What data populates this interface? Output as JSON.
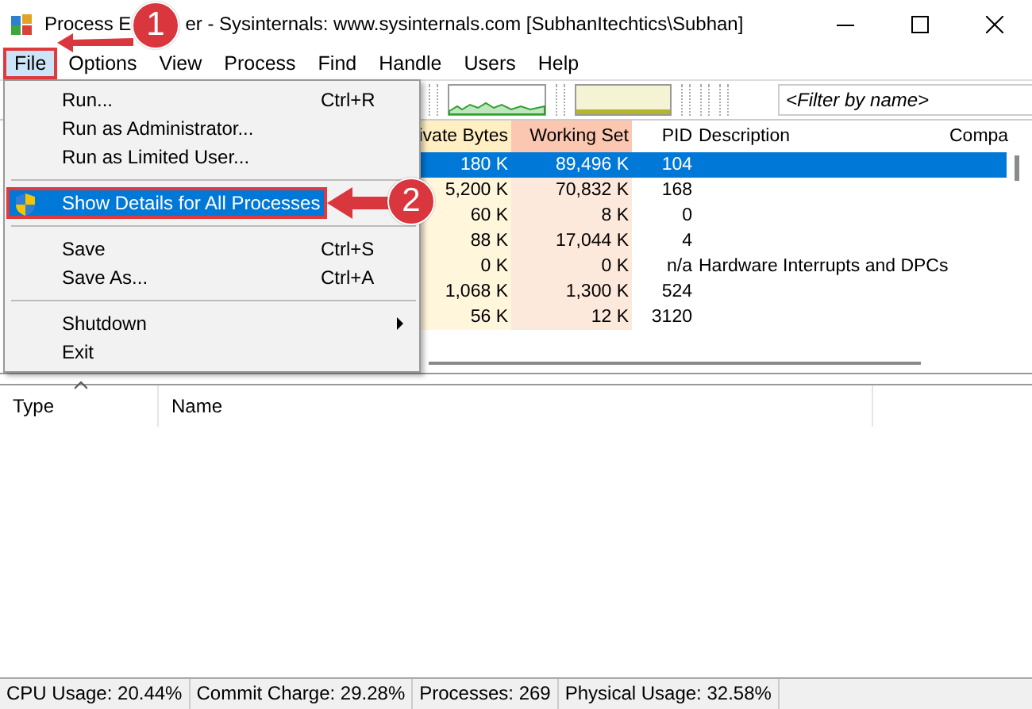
{
  "window": {
    "title_parts": [
      "Process E",
      "er - Sysinternals: www.sysinternals.com [SubhanItechtics\\Subhan]"
    ]
  },
  "menu_bar": [
    {
      "label": "File",
      "selected": true
    },
    {
      "label": "Options",
      "selected": false
    },
    {
      "label": "View",
      "selected": false
    },
    {
      "label": "Process",
      "selected": false
    },
    {
      "label": "Find",
      "selected": false
    },
    {
      "label": "Handle",
      "selected": false
    },
    {
      "label": "Users",
      "selected": false
    },
    {
      "label": "Help",
      "selected": false
    }
  ],
  "file_menu": [
    {
      "kind": "item",
      "label": "Run...",
      "shortcut": "Ctrl+R",
      "selected": false
    },
    {
      "kind": "item",
      "label": "Run as Administrator...",
      "selected": false
    },
    {
      "kind": "item",
      "label": "Run as Limited User...",
      "selected": false
    },
    {
      "kind": "separator"
    },
    {
      "kind": "admin-item",
      "label": "Show Details for All Processes",
      "selected": true
    },
    {
      "kind": "separator"
    },
    {
      "kind": "item",
      "label": "Save",
      "shortcut": "Ctrl+S",
      "selected": false
    },
    {
      "kind": "item",
      "label": "Save As...",
      "shortcut": "Ctrl+A",
      "selected": false
    },
    {
      "kind": "separator"
    },
    {
      "kind": "submenu",
      "label": "Shutdown",
      "selected": false
    },
    {
      "kind": "item",
      "label": "Exit",
      "selected": false
    }
  ],
  "toolbar": {
    "filter": {
      "placeholder": "<Filter by name>"
    }
  },
  "process_table": {
    "columns": [
      "ivate Bytes",
      "Working Set",
      "PID",
      "Description",
      "Compa"
    ],
    "rows": [
      {
        "private_bytes": "180 K",
        "working_set": "89,496 K",
        "pid": "104",
        "selected": true
      },
      {
        "private_bytes": "5,200 K",
        "working_set": "70,832 K",
        "pid": "168",
        "selected": false
      },
      {
        "private_bytes": "60 K",
        "working_set": "8 K",
        "pid": "0",
        "selected": false
      },
      {
        "private_bytes": "88 K",
        "working_set": "17,044 K",
        "pid": "4",
        "selected": false
      },
      {
        "private_bytes": "0 K",
        "working_set": "0 K",
        "pid": "n/a",
        "description": "Hardware Interrupts and DPCs",
        "selected": false
      },
      {
        "private_bytes": "1,068 K",
        "working_set": "1,300 K",
        "pid": "524",
        "selected": false
      },
      {
        "private_bytes": "56 K",
        "working_set": "12 K",
        "pid": "3120",
        "selected": false
      }
    ]
  },
  "lower_pane": {
    "columns": [
      "Type",
      "Name"
    ]
  },
  "status_bar": [
    "CPU Usage: 20.44%",
    "Commit Charge: 29.28%",
    "Processes: 269",
    "Physical Usage: 32.58%"
  ],
  "callouts": [
    {
      "label": "1"
    },
    {
      "label": "2"
    }
  ]
}
